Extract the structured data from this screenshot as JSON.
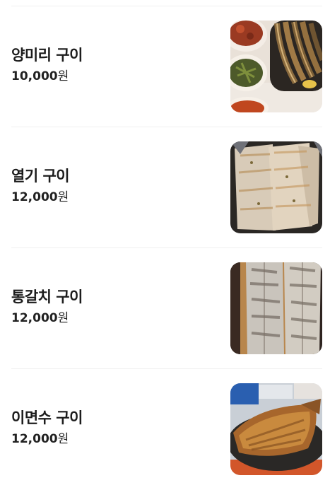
{
  "menu": {
    "items": [
      {
        "name": "양미리 구이",
        "price": "10,000",
        "currency": "원",
        "photo_icon": "grilled-sand-eel-photo"
      },
      {
        "name": "열기 구이",
        "price": "12,000",
        "currency": "원",
        "photo_icon": "grilled-rockfish-photo"
      },
      {
        "name": "통갈치 구이",
        "price": "12,000",
        "currency": "원",
        "photo_icon": "grilled-whole-hairtail-photo"
      },
      {
        "name": "이면수 구이",
        "price": "12,000",
        "currency": "원",
        "photo_icon": "grilled-atka-mackerel-photo"
      }
    ]
  },
  "colors": {
    "divider": "#f0f0f0",
    "text": "#1c1c1c",
    "background": "#ffffff"
  }
}
